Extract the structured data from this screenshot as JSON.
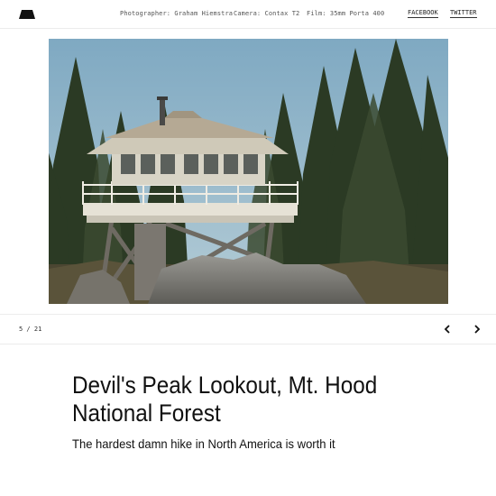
{
  "header": {
    "logo_icon": "mountain-logo-icon",
    "photographer": "Photographer: Graham Hiemstra",
    "camera": "Camera: Contax T2",
    "film": "Film: 35mm Porta 400",
    "social": {
      "facebook": "FACEBOOK",
      "twitter": "TWITTER"
    }
  },
  "photo": {
    "subject": "fire-lookout-tower-photo"
  },
  "gallery": {
    "counter": "5 / 21",
    "prev_icon": "chevron-left-icon",
    "next_icon": "chevron-right-icon"
  },
  "article": {
    "title": "Devil's Peak Lookout, Mt. Hood National Forest",
    "subtitle": "The hardest damn hike in North America is worth it"
  }
}
